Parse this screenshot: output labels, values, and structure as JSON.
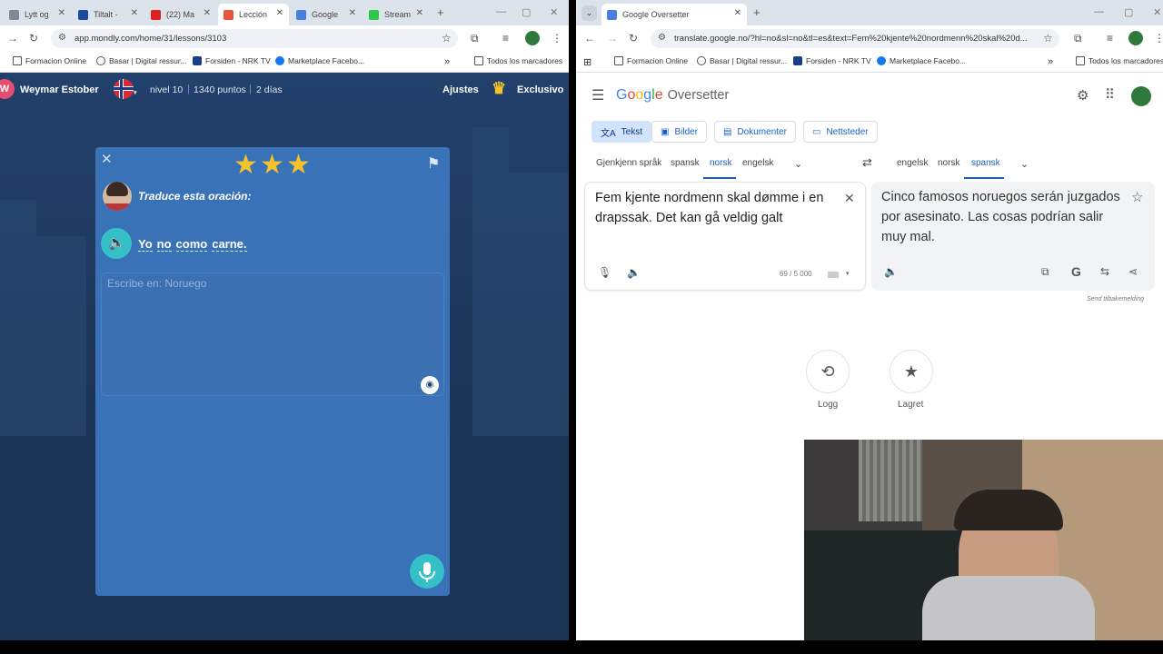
{
  "left": {
    "tabs": [
      {
        "label": "Lytt og",
        "fav": "#7a8a99"
      },
      {
        "label": "Tiltalt -",
        "fav": "#1b4b9a"
      },
      {
        "label": "(22) Ma",
        "fav": "#e01f1f"
      },
      {
        "label": "Lección",
        "fav": "#e8533f"
      },
      {
        "label": "Google",
        "fav": "#4a7fe0"
      },
      {
        "label": "Stream",
        "fav": "#29c94b"
      }
    ],
    "url": "app.mondly.com/home/31/lessons/3103",
    "bookmarks": [
      "Formacion Online",
      "Basar | Digital ressur...",
      "Forsiden - NRK TV",
      "Marketplace Facebo..."
    ],
    "bookmarks_more": "»",
    "all_bookmarks": "Todos los marcadores",
    "app": {
      "avatar_letter": "W",
      "user": "Weymar Estober",
      "level": "nivel 10",
      "points": "1340 puntos",
      "days": "2 días",
      "settings": "Ajustes",
      "premium": "Exclusivo"
    },
    "card": {
      "stars": 3,
      "instruction": "Traduce esta oración:",
      "sentence": [
        "Yo",
        "no",
        "como",
        "carne."
      ],
      "placeholder": "Escribe en: Noruego"
    }
  },
  "right": {
    "tab": {
      "label": "Google Oversetter",
      "fav": "#4a7fe0"
    },
    "url": "translate.google.no/?hl=no&sl=no&tl=es&text=Fem%20kjente%20nordmenn%20skal%20d...",
    "bookmarks": [
      "Formacion Online",
      "Basar | Digital ressur...",
      "Forsiden - NRK TV",
      "Marketplace Facebo..."
    ],
    "bookmarks_more": "»",
    "all_bookmarks": "Todos los marcadores",
    "google": {
      "logo_g": [
        "G",
        "o",
        "o",
        "g",
        "l",
        "e"
      ],
      "logo_colors": [
        "#4285f4",
        "#ea4335",
        "#fbbc05",
        "#4285f4",
        "#34a853",
        "#ea4335"
      ],
      "product": "Oversetter",
      "modes": [
        "Tekst",
        "Bilder",
        "Dokumenter",
        "Nettsteder"
      ],
      "source_langs": [
        "Gjenkjenn språk",
        "spansk",
        "norsk",
        "engelsk"
      ],
      "target_langs": [
        "engelsk",
        "norsk",
        "spansk"
      ],
      "source_text": "Fem kjente nordmenn skal dømme i en drapssak.  Det kan gå veldig galt",
      "char_count": "69 / 5 000",
      "target_text": "Cinco famosos noruegos serán juzgados por asesinato. Las cosas podrían salir muy mal.",
      "feedback": "Send tilbakemelding",
      "history": "Logg",
      "saved": "Lagret"
    }
  }
}
